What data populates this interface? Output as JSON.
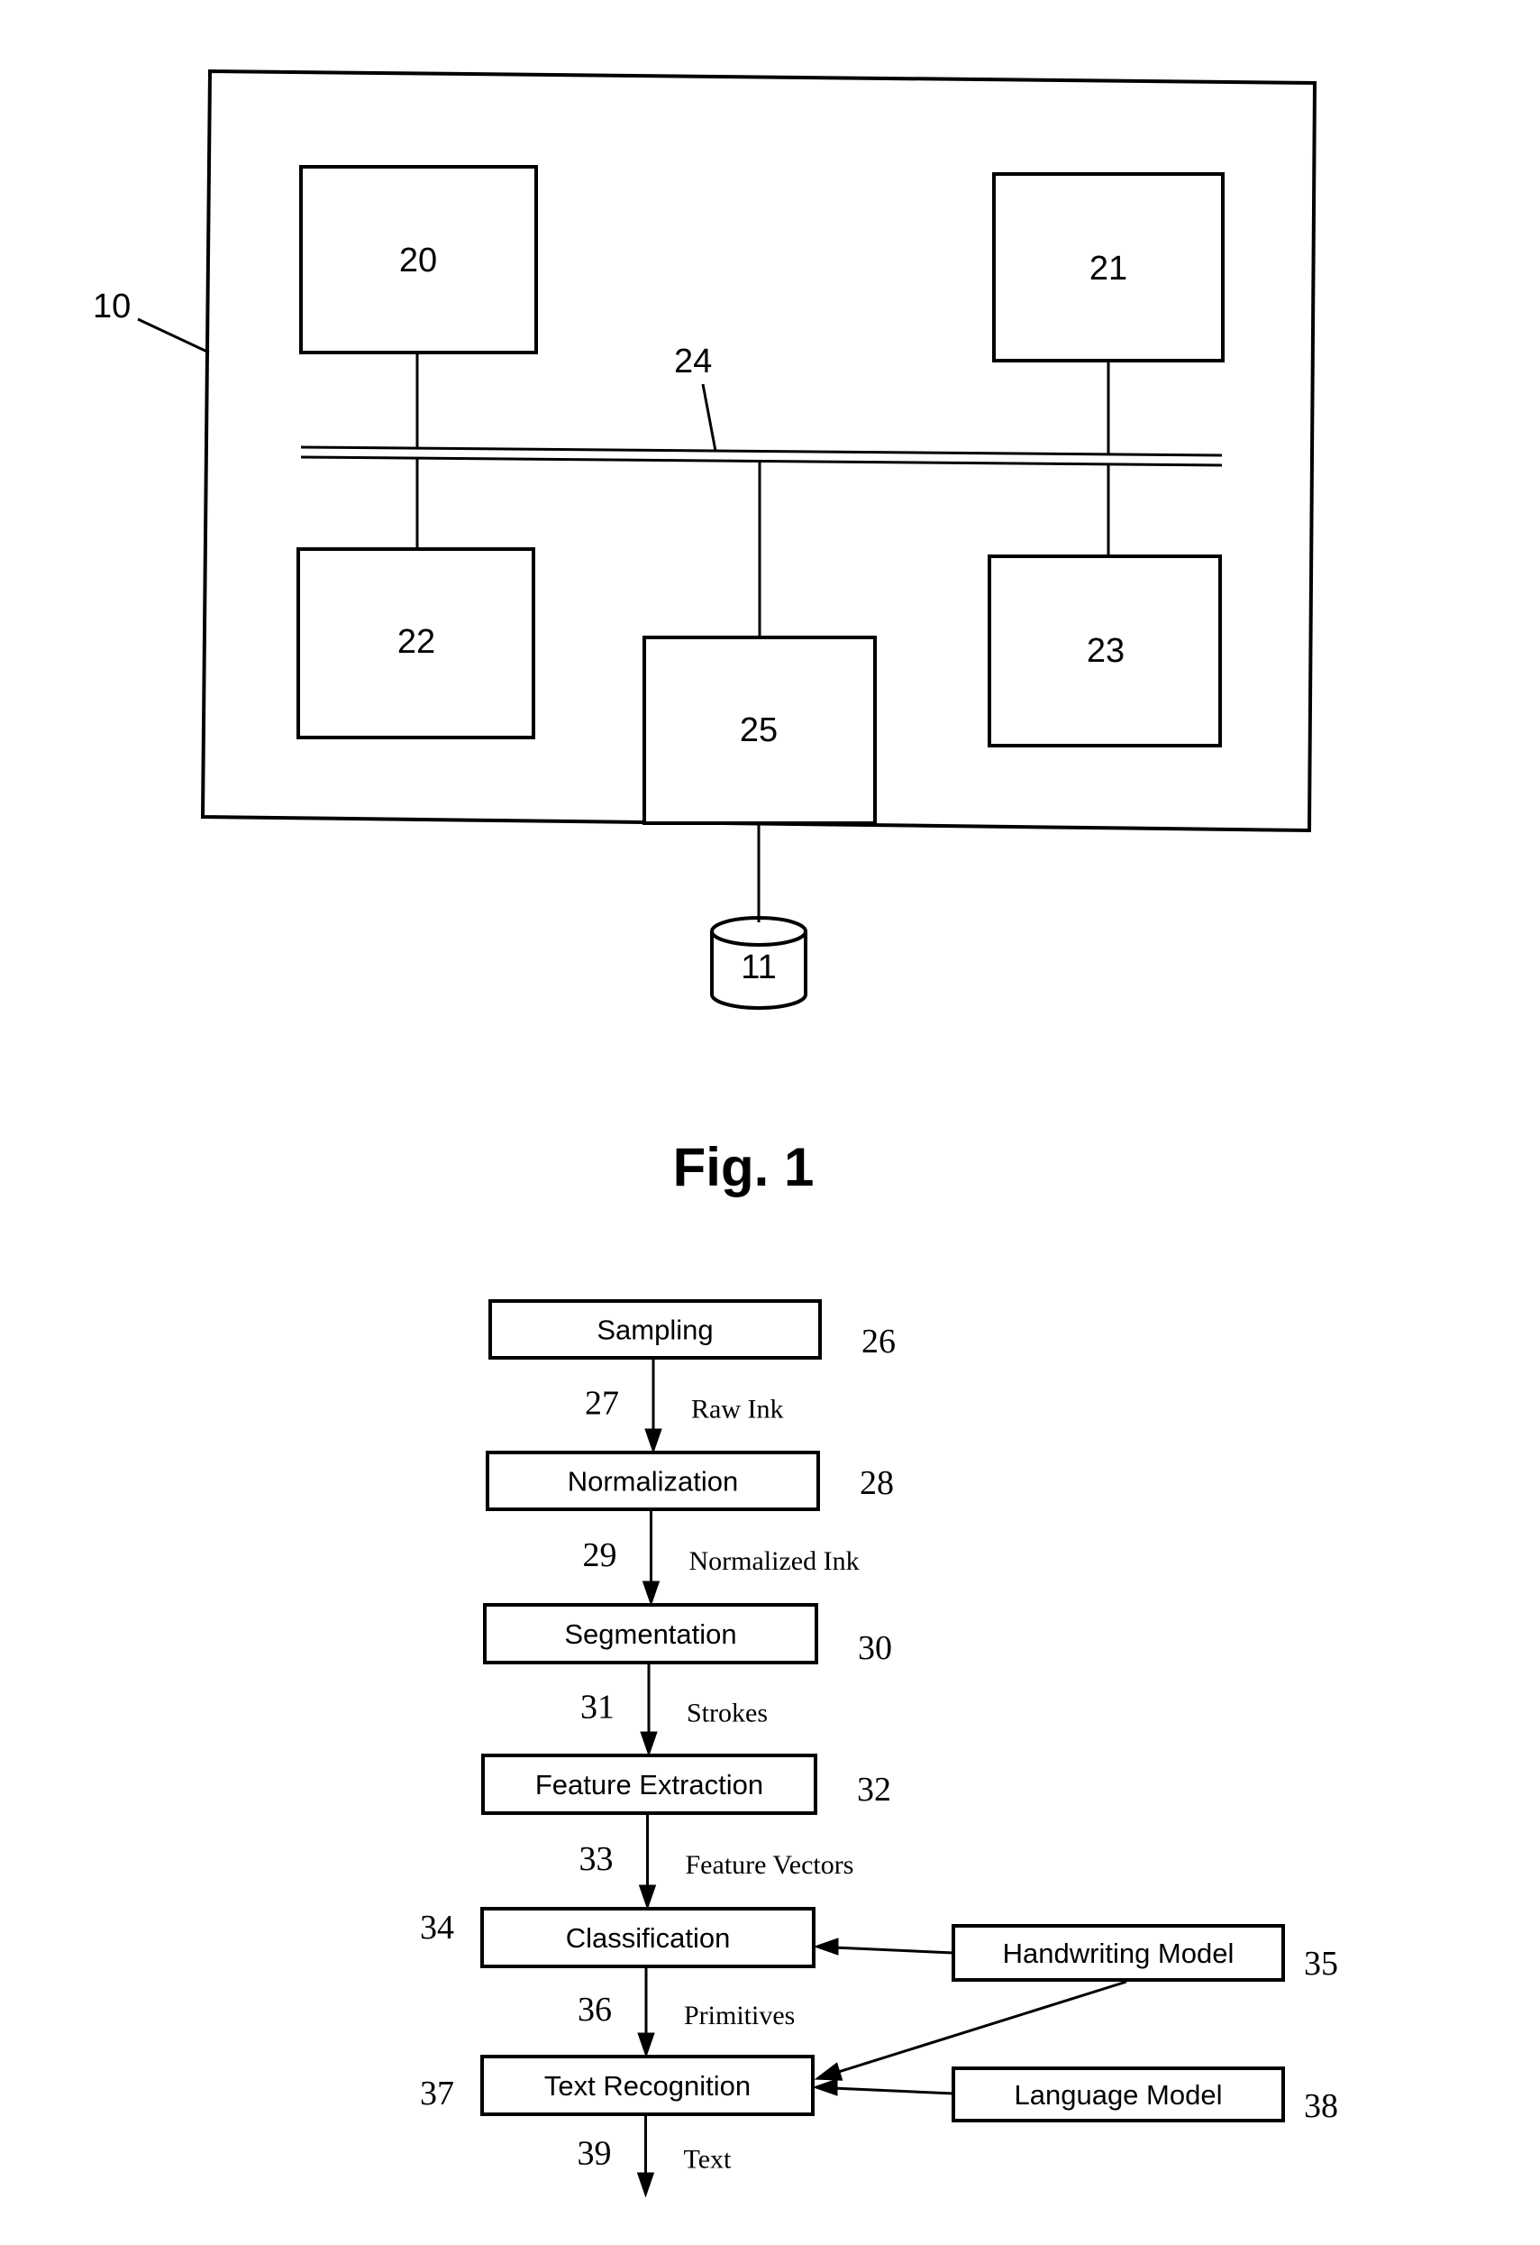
{
  "figure1": {
    "caption": "Fig. 1",
    "system_label": "10",
    "bus_label": "24",
    "components": [
      {
        "id": "20",
        "label": "20"
      },
      {
        "id": "21",
        "label": "21"
      },
      {
        "id": "22",
        "label": "22"
      },
      {
        "id": "23",
        "label": "23"
      },
      {
        "id": "25",
        "label": "25"
      }
    ],
    "storage": {
      "id": "11",
      "label": "11"
    }
  },
  "figure2": {
    "steps": [
      {
        "name": "Sampling",
        "ref": "26"
      },
      {
        "name": "Normalization",
        "ref": "28"
      },
      {
        "name": "Segmentation",
        "ref": "30"
      },
      {
        "name": "Feature Extraction",
        "ref": "32"
      },
      {
        "name": "Classification",
        "ref": "34"
      },
      {
        "name": "Text Recognition",
        "ref": "37"
      }
    ],
    "flows": [
      {
        "ref": "27",
        "label": "Raw Ink"
      },
      {
        "ref": "29",
        "label": "Normalized Ink"
      },
      {
        "ref": "31",
        "label": "Strokes"
      },
      {
        "ref": "33",
        "label": "Feature Vectors"
      },
      {
        "ref": "36",
        "label": "Primitives"
      },
      {
        "ref": "39",
        "label": "Text"
      }
    ],
    "models": [
      {
        "name": "Handwriting Model",
        "ref": "35"
      },
      {
        "name": "Language Model",
        "ref": "38"
      }
    ]
  }
}
